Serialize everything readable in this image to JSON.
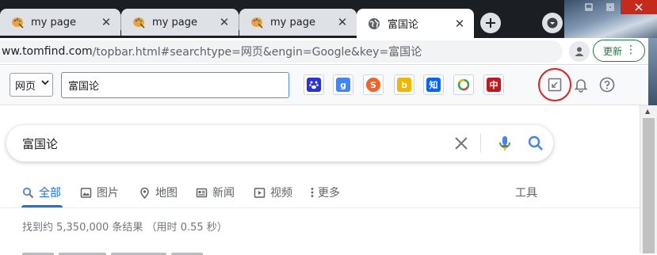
{
  "browser": {
    "tabs": [
      {
        "title": "my page",
        "icon": "palette-favicon-icon",
        "active": false
      },
      {
        "title": "my page",
        "icon": "palette-favicon-icon",
        "active": false
      },
      {
        "title": "my page",
        "icon": "palette-favicon-icon",
        "active": false
      },
      {
        "title": "富国论",
        "icon": "globe-icon",
        "active": true
      }
    ],
    "url_host": "ww.tomfind.com",
    "url_rest": "/topbar.html#searchtype=网页&engin=Google&key=富国论",
    "update_label": "更新"
  },
  "extension_bar": {
    "type_select": "网页",
    "query": "富国论",
    "engines": [
      {
        "name": "baidu",
        "glyph": "🐾",
        "color": "#2932e1"
      },
      {
        "name": "google",
        "glyph": "g",
        "color": "#4285f4"
      },
      {
        "name": "sogou",
        "glyph": "S",
        "color": "#fb6022"
      },
      {
        "name": "bing",
        "glyph": "b",
        "color": "#f4b400"
      },
      {
        "name": "zhihu",
        "glyph": "知",
        "color": "#0066ff"
      },
      {
        "name": "360",
        "glyph": "Q",
        "color": "#2ea44f"
      },
      {
        "name": "zhongsou",
        "glyph": "中",
        "color": "#c4161c"
      }
    ]
  },
  "google": {
    "query": "富国论",
    "tabs": [
      {
        "label": "全部",
        "icon": "search-icon",
        "active": true
      },
      {
        "label": "图片",
        "icon": "image-icon",
        "active": false
      },
      {
        "label": "地图",
        "icon": "map-pin-icon",
        "active": false
      },
      {
        "label": "新闻",
        "icon": "news-icon",
        "active": false
      },
      {
        "label": "视频",
        "icon": "play-icon",
        "active": false
      },
      {
        "label": "更多",
        "icon": "more-vert-icon",
        "active": false
      }
    ],
    "tools_label": "工具",
    "result_stats": "找到约 5,350,000 条结果 （用时 0.55 秒）"
  }
}
